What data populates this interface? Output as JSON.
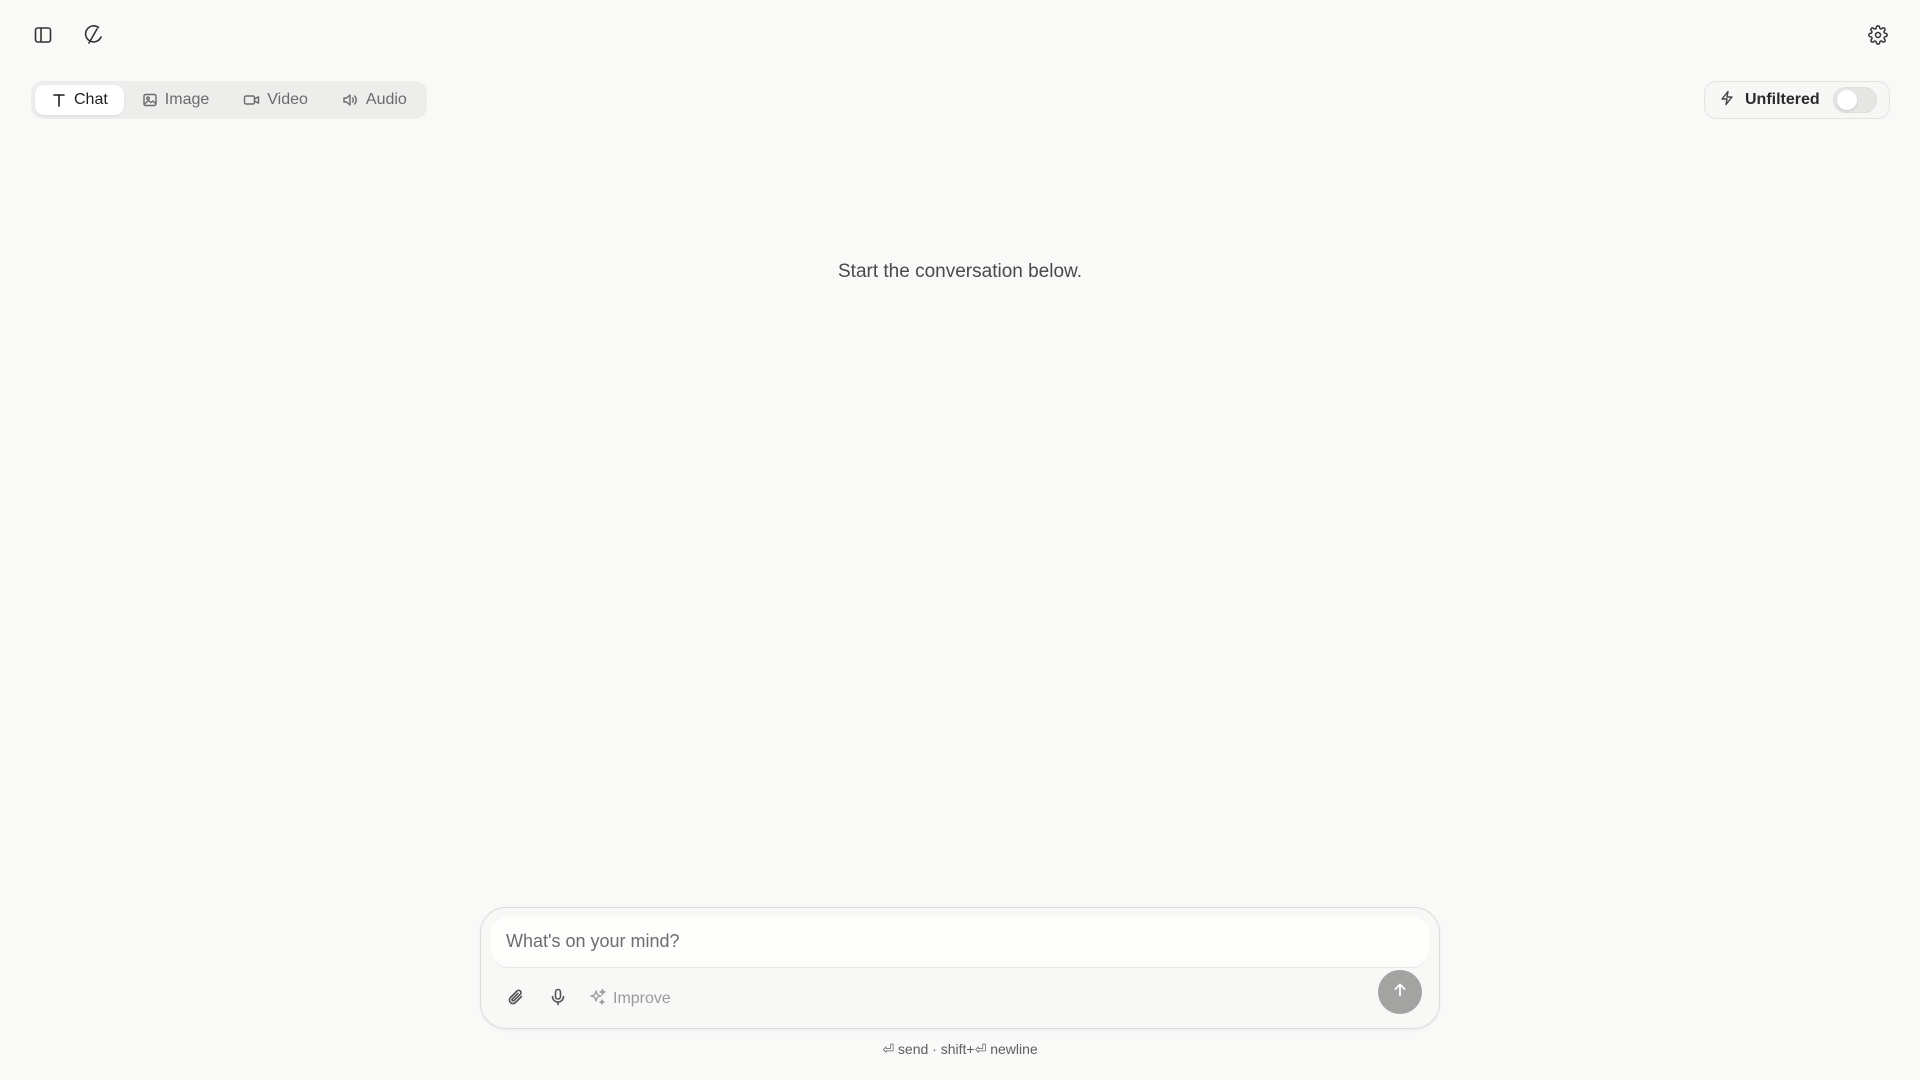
{
  "topbar": {
    "sidebar_toggle_icon": "sidebar-panel-icon",
    "new_chat_icon": "new-chat-logo-icon",
    "settings_icon": "gear-icon"
  },
  "mode_tabs": [
    {
      "label": "Chat",
      "icon": "text-T-icon",
      "active": true
    },
    {
      "label": "Image",
      "icon": "image-icon",
      "active": false
    },
    {
      "label": "Video",
      "icon": "video-camera-icon",
      "active": false
    },
    {
      "label": "Audio",
      "icon": "speaker-icon",
      "active": false
    }
  ],
  "unfiltered": {
    "label": "Unfiltered",
    "icon": "lightning-bolt-icon",
    "enabled": false
  },
  "main": {
    "empty_message": "Start the conversation below."
  },
  "composer": {
    "placeholder": "What's on your mind?",
    "value": "",
    "attach_icon": "paperclip-icon",
    "mic_icon": "microphone-icon",
    "improve_label": "Improve",
    "improve_icon": "sparkles-icon",
    "send_icon": "arrow-up-icon",
    "hint": "⏎ send · shift+⏎ newline"
  },
  "colors": {
    "background": "#f9f9f8",
    "tab_bar": "#ededeb",
    "send_button": "#a3a3a2"
  }
}
